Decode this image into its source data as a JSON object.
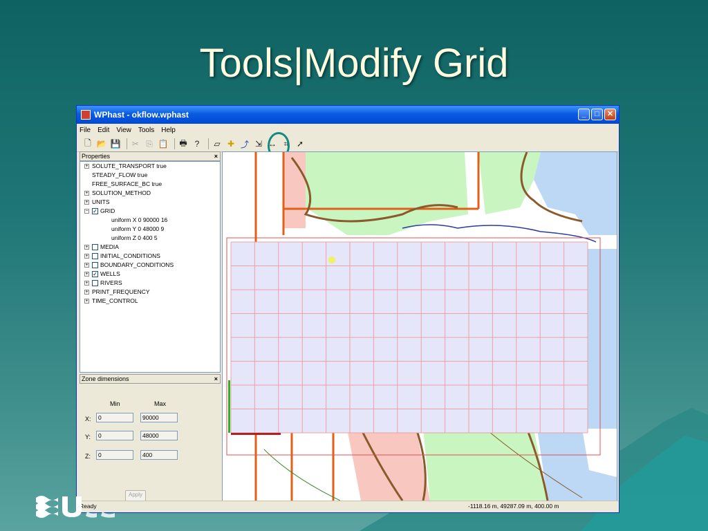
{
  "slide": {
    "title": "Tools|Modify Grid"
  },
  "window": {
    "title": "WPhast - okflow.wphast",
    "controls": {
      "minimize": "_",
      "maximize": "□",
      "close": "✕"
    }
  },
  "menu": [
    "File",
    "Edit",
    "View",
    "Tools",
    "Help"
  ],
  "toolbar": {
    "icons": [
      "new-icon",
      "open-icon",
      "save-icon",
      "cut-icon",
      "copy-icon",
      "paste-icon",
      "print-icon",
      "help-icon",
      "zone-icon",
      "add-well-icon",
      "add-river-icon",
      "modify-grid-icon",
      "select-icon"
    ]
  },
  "properties": {
    "header": "Properties",
    "close": "×",
    "items": [
      {
        "label": "SOLUTE_TRANSPORT true",
        "expand": "+",
        "indent": 0,
        "checkbox": null
      },
      {
        "label": "STEADY_FLOW true",
        "expand": null,
        "indent": 0,
        "checkbox": null
      },
      {
        "label": "FREE_SURFACE_BC true",
        "expand": null,
        "indent": 0,
        "checkbox": null
      },
      {
        "label": "SOLUTION_METHOD",
        "expand": "+",
        "indent": 0,
        "checkbox": null
      },
      {
        "label": "UNITS",
        "expand": "+",
        "indent": 0,
        "checkbox": null
      },
      {
        "label": "GRID",
        "expand": "-",
        "indent": 0,
        "checkbox": true
      },
      {
        "label": "uniform X 0 90000 16",
        "expand": null,
        "indent": 1,
        "checkbox": null
      },
      {
        "label": "uniform Y 0 48000 9",
        "expand": null,
        "indent": 1,
        "checkbox": null
      },
      {
        "label": "uniform Z 0 400 5",
        "expand": null,
        "indent": 1,
        "checkbox": null
      },
      {
        "label": "MEDIA",
        "expand": "+",
        "indent": 0,
        "checkbox": false
      },
      {
        "label": "INITIAL_CONDITIONS",
        "expand": "+",
        "indent": 0,
        "checkbox": false
      },
      {
        "label": "BOUNDARY_CONDITIONS",
        "expand": "+",
        "indent": 0,
        "checkbox": false
      },
      {
        "label": "WELLS",
        "expand": "+",
        "indent": 0,
        "checkbox": true
      },
      {
        "label": "RIVERS",
        "expand": "+",
        "indent": 0,
        "checkbox": false
      },
      {
        "label": "PRINT_FREQUENCY",
        "expand": "+",
        "indent": 0,
        "checkbox": null
      },
      {
        "label": "TIME_CONTROL",
        "expand": "+",
        "indent": 0,
        "checkbox": null
      }
    ]
  },
  "zone": {
    "header": "Zone dimensions",
    "close": "×",
    "min_label": "Min",
    "max_label": "Max",
    "rows": [
      {
        "axis": "X:",
        "min": "0",
        "max": "90000"
      },
      {
        "axis": "Y:",
        "min": "0",
        "max": "48000"
      },
      {
        "axis": "Z:",
        "min": "0",
        "max": "400"
      }
    ],
    "apply_label": "Apply"
  },
  "grid": {
    "columns": 15,
    "rows": 8,
    "fill": "#e6e6fa",
    "line": "#f0a0a0"
  },
  "status": {
    "left": "Ready",
    "right": "-1118.16 m, 49287.09 m, 400.00 m"
  },
  "logo": {
    "text": "USGS"
  }
}
